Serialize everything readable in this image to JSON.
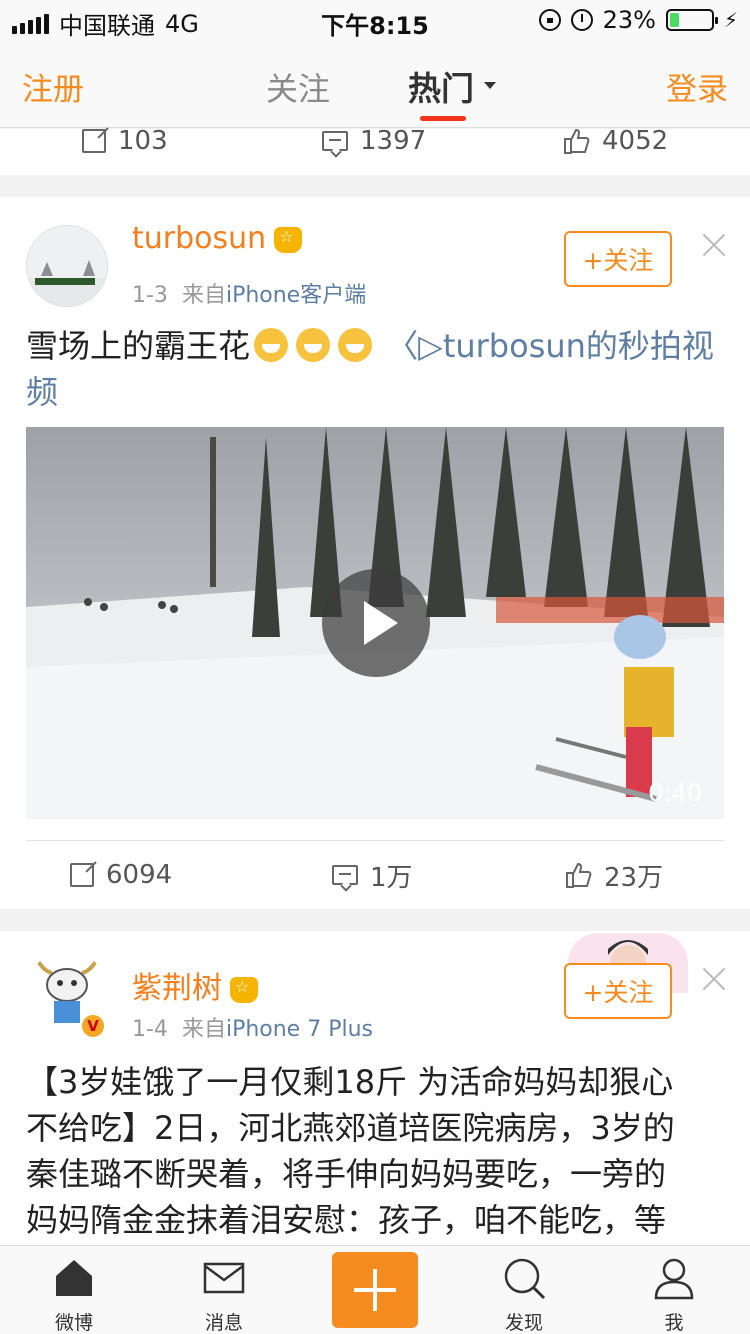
{
  "status_bar": {
    "carrier": "中国联通",
    "network": "4G",
    "time": "下午8:15",
    "battery": "23%",
    "battery_level": 0.23
  },
  "nav": {
    "register": "注册",
    "tab_follow": "关注",
    "tab_hot": "热门",
    "login": "登录"
  },
  "prev_post": {
    "shares": "103",
    "comments": "1397",
    "likes": "4052"
  },
  "post1": {
    "user": "turbosun",
    "date": "1-3",
    "from": "来自",
    "source": "iPhone客户端",
    "follow": "+关注",
    "text": "雪场上的霸王花",
    "video_link": "turbosun的秒拍视频",
    "video_duration": "0:40",
    "shares": "6094",
    "comments": "1万",
    "likes": "23万"
  },
  "post2": {
    "user": "紫荆树",
    "date": "1-4",
    "from": "来自",
    "source": "iPhone 7 Plus",
    "follow": "+关注",
    "text_l1": "【3岁娃饿了一月仅剩18斤 为活命妈妈却狠心",
    "text_l2": "不给吃】2日，河北燕郊道培医院病房，3岁的",
    "text_l3": "秦佳璐不断哭着，将手伸向妈妈要吃，一旁的",
    "text_l4": "妈妈隋金金抹着泪安慰：孩子，咱不能吃，等"
  },
  "tab_bar": {
    "home": "微博",
    "messages": "消息",
    "discover": "发现",
    "me": "我"
  },
  "colors": {
    "accent": "#f68b1f",
    "link": "#5e7ea3",
    "hot_underline": "#f5331b"
  }
}
